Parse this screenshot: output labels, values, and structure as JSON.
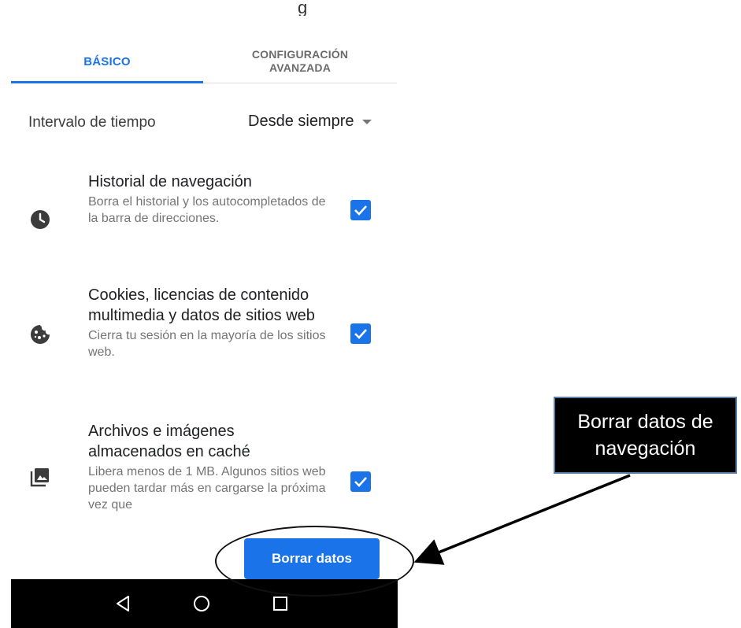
{
  "header": {
    "title_fragment": "g"
  },
  "tabs": [
    {
      "label": "BÁSICO",
      "active": true
    },
    {
      "label": "CONFIGURACIÓN\nAVANZADA",
      "active": false
    }
  ],
  "time_range": {
    "label": "Intervalo de tiempo",
    "value": "Desde siempre"
  },
  "items": [
    {
      "icon": "clock-icon",
      "title": "Historial de navegación",
      "description": "Borra el historial y los autocompletados de la barra de direcciones.",
      "checked": true
    },
    {
      "icon": "cookie-icon",
      "title": "Cookies, licencias de contenido multimedia y datos de sitios web",
      "description": "Cierra tu sesión en la mayoría de los sitios web.",
      "checked": true
    },
    {
      "icon": "images-icon",
      "title": "Archivos e imágenes almacenados en caché",
      "description": "Libera menos de 1 MB. Algunos sitios web pueden tardar más en cargarse la próxima vez que",
      "checked": true
    }
  ],
  "clear_button": {
    "label": "Borrar datos"
  },
  "navbar": {
    "buttons": [
      "back-icon",
      "home-icon",
      "recents-icon"
    ]
  },
  "annotation": {
    "text": "Borrar datos de navegación"
  },
  "colors": {
    "accent": "#1a73e8",
    "navbar": "#000000",
    "annotation_border": "#5b7fa6"
  }
}
